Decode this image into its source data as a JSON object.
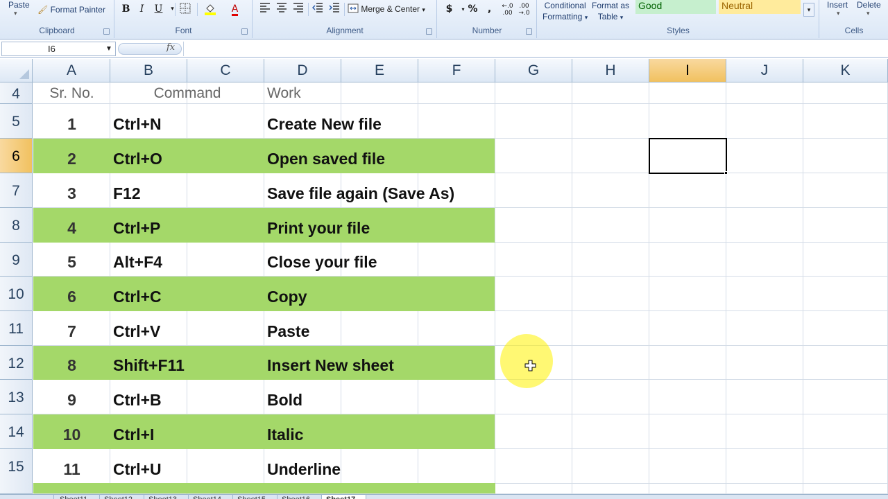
{
  "ribbon": {
    "clipboard": {
      "paste_label": "Paste",
      "format_painter_label": "Format Painter",
      "group_label": "Clipboard"
    },
    "font": {
      "bold": "B",
      "italic": "I",
      "underline": "U",
      "group_label": "Font"
    },
    "alignment": {
      "merge_center_label": "Merge & Center",
      "group_label": "Alignment"
    },
    "number": {
      "currency": "$",
      "percent": "%",
      "comma": ",",
      "group_label": "Number"
    },
    "styles": {
      "conditional_formatting_line1": "Conditional",
      "conditional_formatting_line2": "Formatting",
      "format_as_table_line1": "Format as",
      "format_as_table_line2": "Table",
      "good_label": "Good",
      "neutral_label": "Neutral",
      "group_label": "Styles",
      "good_color": "#c6efce",
      "neutral_color": "#ffeb9c"
    },
    "cells": {
      "insert_label": "Insert",
      "delete_label": "Delete",
      "group_label": "Cells"
    }
  },
  "formula_bar": {
    "name_box": "I6",
    "fx": "fx",
    "formula": ""
  },
  "columns": [
    "A",
    "B",
    "C",
    "D",
    "E",
    "F",
    "G",
    "H",
    "I",
    "J",
    "K"
  ],
  "active_column": "I",
  "active_row": "6",
  "header_row": {
    "row_number": "4",
    "sr_no": "Sr. No.",
    "command": "Command",
    "work": "Work"
  },
  "rows": [
    {
      "row_number": "5",
      "sr": "1",
      "command": "Ctrl+N",
      "work": "Create New file",
      "highlight": false
    },
    {
      "row_number": "6",
      "sr": "2",
      "command": "Ctrl+O",
      "work": "Open saved file",
      "highlight": true
    },
    {
      "row_number": "7",
      "sr": "3",
      "command": "F12",
      "work": "Save file again (Save As)",
      "highlight": false
    },
    {
      "row_number": "8",
      "sr": "4",
      "command": "Ctrl+P",
      "work": "Print your file",
      "highlight": true
    },
    {
      "row_number": "9",
      "sr": "5",
      "command": "Alt+F4",
      "work": "Close your file",
      "highlight": false
    },
    {
      "row_number": "10",
      "sr": "6",
      "command": "Ctrl+C",
      "work": "Copy",
      "highlight": true
    },
    {
      "row_number": "11",
      "sr": "7",
      "command": "Ctrl+V",
      "work": "Paste",
      "highlight": false
    },
    {
      "row_number": "12",
      "sr": "8",
      "command": "Shift+F11",
      "work": "Insert New sheet",
      "highlight": true
    },
    {
      "row_number": "13",
      "sr": "9",
      "command": "Ctrl+B",
      "work": "Bold",
      "highlight": false
    },
    {
      "row_number": "14",
      "sr": "10",
      "command": "Ctrl+I",
      "work": "Italic",
      "highlight": true
    },
    {
      "row_number": "15",
      "sr": "11",
      "command": "Ctrl+U",
      "work": "Underline",
      "highlight": false
    }
  ],
  "colors": {
    "row_highlight": "#a4d869",
    "header_active": "#f1c15f"
  },
  "sheet_tabs": [
    "Sheet11",
    "Sheet12",
    "Sheet13",
    "Sheet14",
    "Sheet15",
    "Sheet16",
    "Sheet17"
  ],
  "active_sheet": "Sheet17"
}
